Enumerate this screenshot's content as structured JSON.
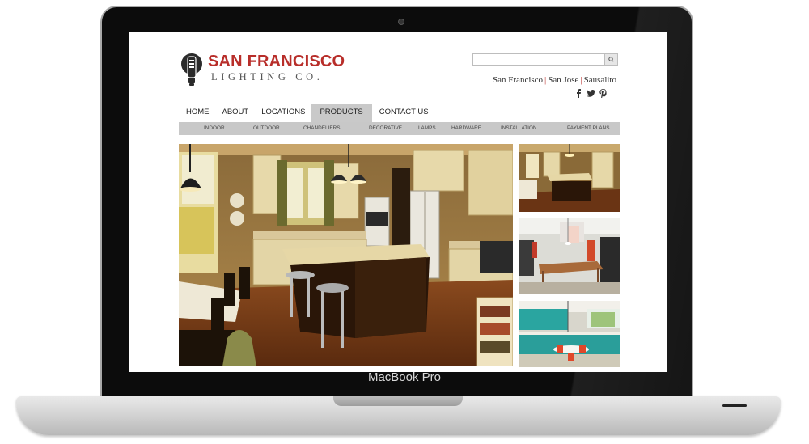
{
  "device": {
    "label": "MacBook Pro"
  },
  "site": {
    "logo_name": "SAN FRANCISCO",
    "logo_sub": "LIGHTING CO.",
    "brand_color": "#b82e2a"
  },
  "search": {
    "icon": "search-icon",
    "value": ""
  },
  "locations": [
    "San Francisco",
    "San Jose",
    "Sausalito"
  ],
  "social": [
    "facebook-icon",
    "twitter-icon",
    "pinterest-icon"
  ],
  "nav": [
    {
      "label": "HOME"
    },
    {
      "label": "ABOUT"
    },
    {
      "label": "LOCATIONS"
    },
    {
      "label": "PRODUCTS",
      "active": true
    },
    {
      "label": "CONTACT US"
    }
  ],
  "subnav": [
    "INDOOR",
    "OUTDOOR",
    "CHANDELIERS",
    "DECORATIVE",
    "LAMPS",
    "HARDWARE",
    "INSTALLATION",
    "PAYMENT PLANS"
  ]
}
